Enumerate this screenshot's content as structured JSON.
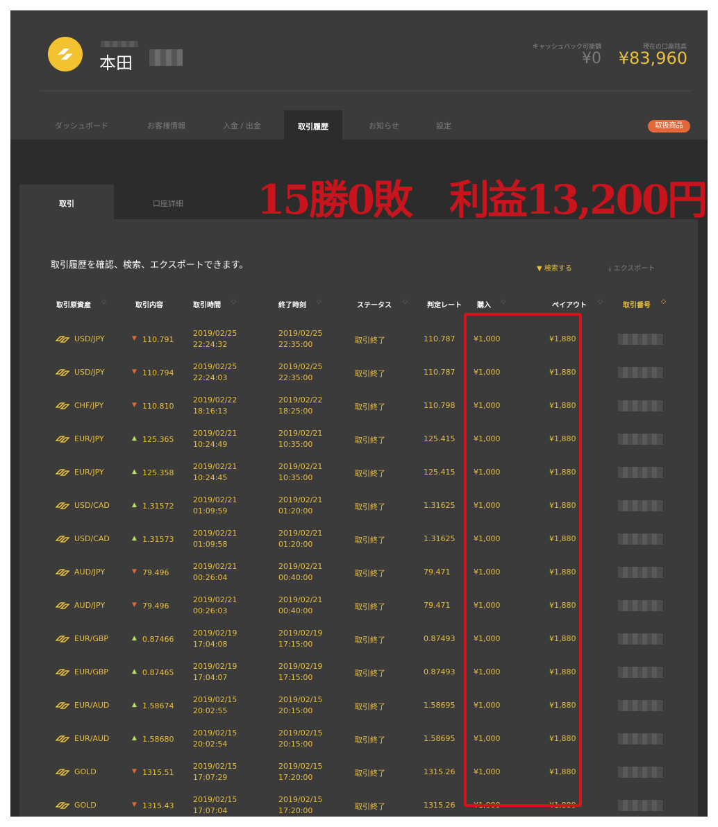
{
  "header": {
    "user_name": "本田",
    "cashback_label": "キャッシュバック可能額",
    "cashback_value": "¥0",
    "balance_label": "現在の口座残高",
    "balance_value": "¥83,960"
  },
  "nav": {
    "tabs": [
      "ダッシュボード",
      "お客様情報",
      "入金 / 出金",
      "取引履歴",
      "お知らせ",
      "設定"
    ],
    "active": "取引履歴",
    "products_button": "取扱商品"
  },
  "subtabs": {
    "trades": "取引",
    "account_details": "口座詳細"
  },
  "overlay": {
    "text": "15勝0敗　利益13,200円"
  },
  "intro": "取引履歴を確認、検索、エクスポートできます。",
  "actions": {
    "search": "検索する",
    "export": "エクスポート"
  },
  "table": {
    "headers": [
      "取引原資産",
      "取引内容",
      "取引時間",
      "終了時刻",
      "ステータス",
      "判定レート",
      "購入",
      "ペイアウト",
      "取引番号"
    ],
    "rows": [
      {
        "asset": "USD/JPY",
        "dir": "down",
        "rate": "110.791",
        "t_date": "2019/02/25",
        "t_time": "22:24:32",
        "e_date": "2019/02/25",
        "e_time": "22:35:00",
        "status": "取引終了",
        "judge": "110.787",
        "buy": "¥1,000",
        "payout": "¥1,880"
      },
      {
        "asset": "USD/JPY",
        "dir": "down",
        "rate": "110.794",
        "t_date": "2019/02/25",
        "t_time": "22:24:03",
        "e_date": "2019/02/25",
        "e_time": "22:35:00",
        "status": "取引終了",
        "judge": "110.787",
        "buy": "¥1,000",
        "payout": "¥1,880"
      },
      {
        "asset": "CHF/JPY",
        "dir": "down",
        "rate": "110.810",
        "t_date": "2019/02/22",
        "t_time": "18:16:13",
        "e_date": "2019/02/22",
        "e_time": "18:25:00",
        "status": "取引終了",
        "judge": "110.798",
        "buy": "¥1,000",
        "payout": "¥1,880"
      },
      {
        "asset": "EUR/JPY",
        "dir": "up",
        "rate": "125.365",
        "t_date": "2019/02/21",
        "t_time": "10:24:49",
        "e_date": "2019/02/21",
        "e_time": "10:35:00",
        "status": "取引終了",
        "judge": "125.415",
        "buy": "¥1,000",
        "payout": "¥1,880"
      },
      {
        "asset": "EUR/JPY",
        "dir": "up",
        "rate": "125.358",
        "t_date": "2019/02/21",
        "t_time": "10:24:45",
        "e_date": "2019/02/21",
        "e_time": "10:35:00",
        "status": "取引終了",
        "judge": "125.415",
        "buy": "¥1,000",
        "payout": "¥1,880"
      },
      {
        "asset": "USD/CAD",
        "dir": "up",
        "rate": "1.31572",
        "t_date": "2019/02/21",
        "t_time": "01:09:59",
        "e_date": "2019/02/21",
        "e_time": "01:20:00",
        "status": "取引終了",
        "judge": "1.31625",
        "buy": "¥1,000",
        "payout": "¥1,880"
      },
      {
        "asset": "USD/CAD",
        "dir": "up",
        "rate": "1.31573",
        "t_date": "2019/02/21",
        "t_time": "01:09:58",
        "e_date": "2019/02/21",
        "e_time": "01:20:00",
        "status": "取引終了",
        "judge": "1.31625",
        "buy": "¥1,000",
        "payout": "¥1,880"
      },
      {
        "asset": "AUD/JPY",
        "dir": "down",
        "rate": "79.496",
        "t_date": "2019/02/21",
        "t_time": "00:26:04",
        "e_date": "2019/02/21",
        "e_time": "00:40:00",
        "status": "取引終了",
        "judge": "79.471",
        "buy": "¥1,000",
        "payout": "¥1,880"
      },
      {
        "asset": "AUD/JPY",
        "dir": "down",
        "rate": "79.496",
        "t_date": "2019/02/21",
        "t_time": "00:26:03",
        "e_date": "2019/02/21",
        "e_time": "00:40:00",
        "status": "取引終了",
        "judge": "79.471",
        "buy": "¥1,000",
        "payout": "¥1,880"
      },
      {
        "asset": "EUR/GBP",
        "dir": "up",
        "rate": "0.87466",
        "t_date": "2019/02/19",
        "t_time": "17:04:08",
        "e_date": "2019/02/19",
        "e_time": "17:15:00",
        "status": "取引終了",
        "judge": "0.87493",
        "buy": "¥1,000",
        "payout": "¥1,880"
      },
      {
        "asset": "EUR/GBP",
        "dir": "up",
        "rate": "0.87465",
        "t_date": "2019/02/19",
        "t_time": "17:04:07",
        "e_date": "2019/02/19",
        "e_time": "17:15:00",
        "status": "取引終了",
        "judge": "0.87493",
        "buy": "¥1,000",
        "payout": "¥1,880"
      },
      {
        "asset": "EUR/AUD",
        "dir": "up",
        "rate": "1.58674",
        "t_date": "2019/02/15",
        "t_time": "20:02:55",
        "e_date": "2019/02/15",
        "e_time": "20:15:00",
        "status": "取引終了",
        "judge": "1.58695",
        "buy": "¥1,000",
        "payout": "¥1,880"
      },
      {
        "asset": "EUR/AUD",
        "dir": "up",
        "rate": "1.58680",
        "t_date": "2019/02/15",
        "t_time": "20:02:54",
        "e_date": "2019/02/15",
        "e_time": "20:15:00",
        "status": "取引終了",
        "judge": "1.58695",
        "buy": "¥1,000",
        "payout": "¥1,880"
      },
      {
        "asset": "GOLD",
        "dir": "down",
        "rate": "1315.51",
        "t_date": "2019/02/15",
        "t_time": "17:07:29",
        "e_date": "2019/02/15",
        "e_time": "17:20:00",
        "status": "取引終了",
        "judge": "1315.26",
        "buy": "¥1,000",
        "payout": "¥1,880"
      },
      {
        "asset": "GOLD",
        "dir": "down",
        "rate": "1315.43",
        "t_date": "2019/02/15",
        "t_time": "17:07:04",
        "e_date": "2019/02/15",
        "e_time": "17:20:00",
        "status": "取引終了",
        "judge": "1315.26",
        "buy": "¥1,000",
        "payout": "¥1,880"
      }
    ]
  },
  "colors": {
    "accent": "#e8bf3d",
    "down": "#e4673a",
    "up": "#b9e15b",
    "highlight": "#d2151d",
    "panel": "#3b3b3b"
  }
}
